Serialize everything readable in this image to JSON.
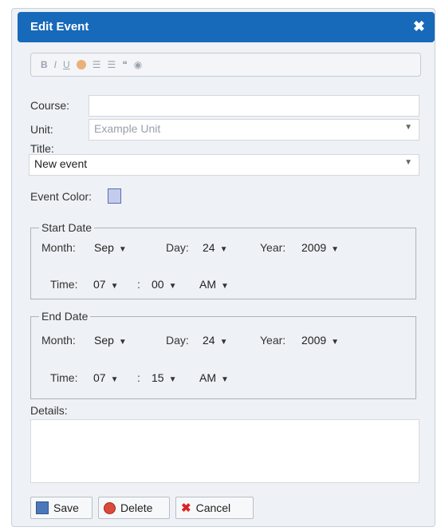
{
  "dialog": {
    "title": "Edit Event",
    "close_glyph": "✖"
  },
  "toolbar": {
    "items": [
      "B",
      "I",
      "U",
      "●",
      "☰",
      "☰",
      "❝",
      "◉"
    ]
  },
  "form": {
    "course_label": "Course:",
    "course_value": "",
    "unit_label": "Unit:",
    "unit_value": "Example Unit",
    "title_label": "Title:",
    "title_value": "New event",
    "event_color_label": "Event Color:",
    "event_color": "#c3ccee",
    "details_label": "Details:",
    "details_value": ""
  },
  "start": {
    "legend": "Start Date",
    "month_label": "Month:",
    "month": "Sep",
    "day_label": "Day:",
    "day": "24",
    "year_label": "Year:",
    "year": "2009",
    "time_label": "Time:",
    "hour": "07",
    "sep": ":",
    "minute": "00",
    "ampm": "AM"
  },
  "end": {
    "legend": "End Date",
    "month_label": "Month:",
    "month": "Sep",
    "day_label": "Day:",
    "day": "24",
    "year_label": "Year:",
    "year": "2009",
    "time_label": "Time:",
    "hour": "07",
    "sep": ":",
    "minute": "15",
    "ampm": "AM"
  },
  "buttons": {
    "save": "Save",
    "delete": "Delete",
    "cancel": "Cancel"
  },
  "colors": {
    "titlebar": "#1769b9",
    "dialog_bg": "#eef1f5"
  }
}
